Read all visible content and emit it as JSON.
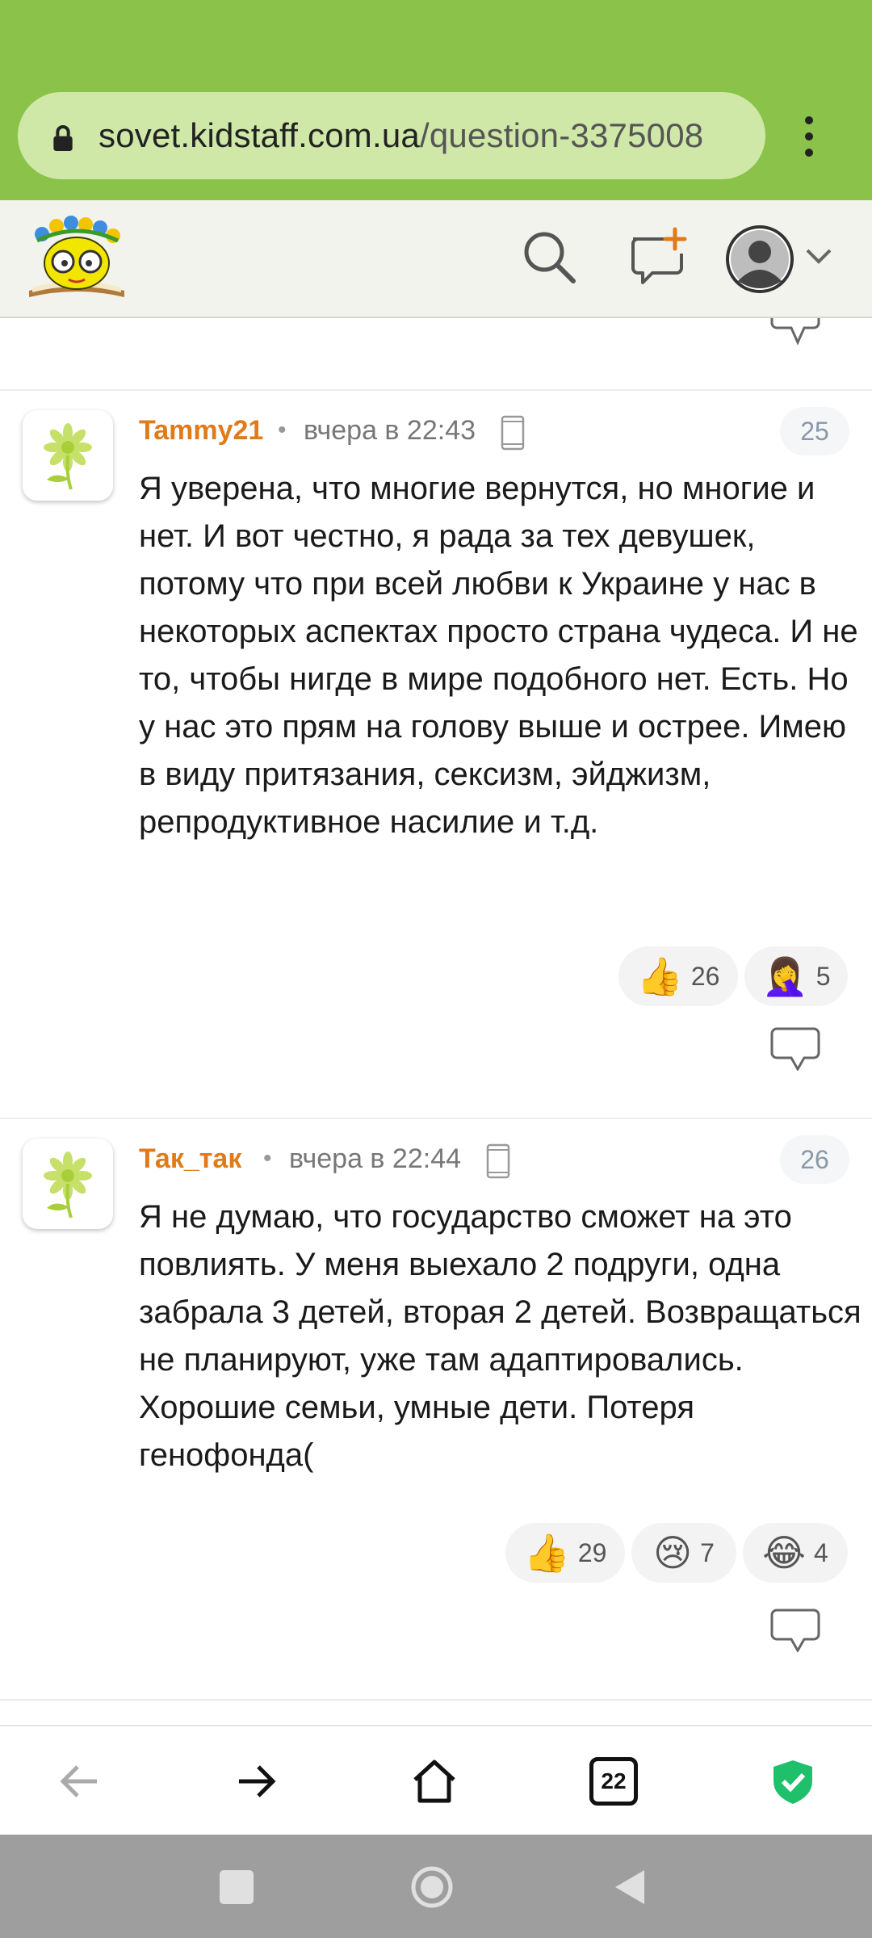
{
  "browser": {
    "url_host": "sovet.kidstaff.com.ua",
    "url_path": "/question-3375008"
  },
  "comments": [
    {
      "author": "Tammy21",
      "time": "вчера в 22:43",
      "number": "25",
      "text": "Я уверена, что многие вернутся, но многие и нет. И вот честно, я рада за тех девушек, потому что при всей любви к Украине у нас в некоторых аспектах просто страна чудеса. И не то, чтобы нигде в мире подобного нет. Есть. Но у нас это прям на голову выше и острее. Имею в виду притязания, сексизм, эйджизм, репродуктивное насилие и т.д.",
      "reactions": [
        {
          "emoji": "👍",
          "icon": "thumbs-up-icon",
          "count": "26"
        },
        {
          "emoji": "🤦‍♀️",
          "icon": "facepalm-icon",
          "count": "5"
        }
      ]
    },
    {
      "author": "Так_так",
      "time": "вчера в 22:44",
      "number": "26",
      "text": "Я не думаю, что государство сможет на это повлиять. У меня выехало 2 подруги, одна забрала 3 детей, вторая 2 детей. Возвращаться не планируют, уже там адаптировались. Хорошие семьи, умные дети. Потеря генофонда(",
      "reactions": [
        {
          "emoji": "👍",
          "icon": "thumbs-up-icon",
          "count": "29"
        },
        {
          "emoji": "😢",
          "icon": "crying-face-icon",
          "count": "7"
        },
        {
          "emoji": "😂",
          "icon": "tears-of-joy-icon",
          "count": "4"
        }
      ]
    }
  ],
  "bottom_nav": {
    "tabs_count": "22"
  },
  "colors": {
    "browser_bar": "#8bc34a",
    "author": "#e07b1a",
    "shield": "#1ec06b"
  }
}
